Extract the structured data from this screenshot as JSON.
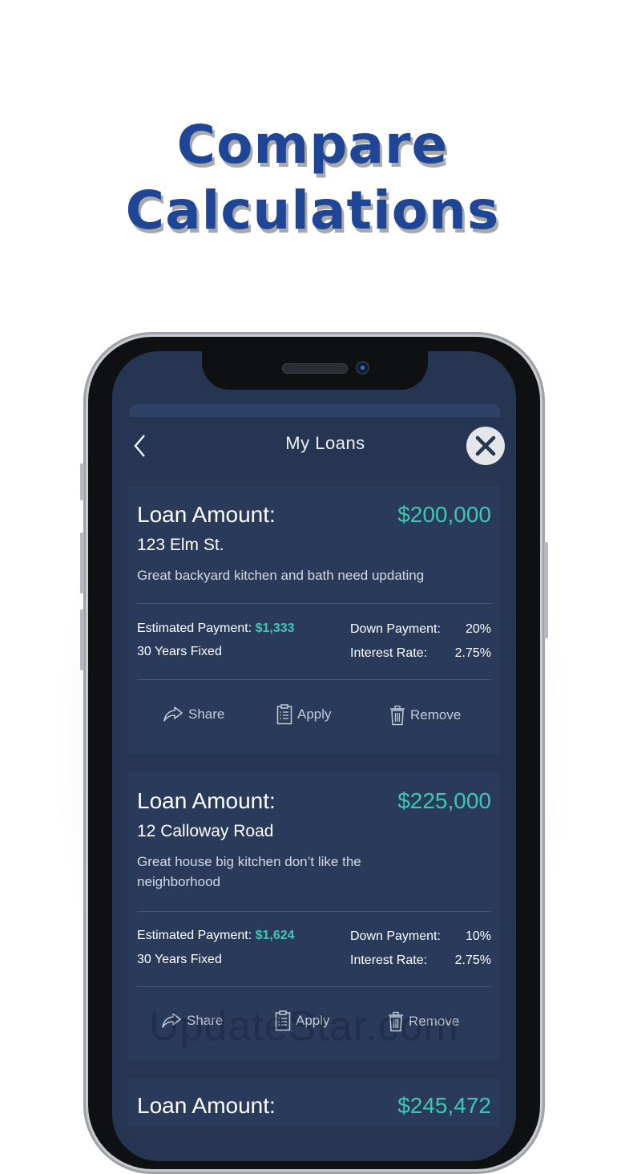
{
  "headline": {
    "line1": "Compare",
    "line2": "Calculations"
  },
  "screen": {
    "title": "My Loans",
    "back_glyph": "‹",
    "close_glyph": "✕"
  },
  "loans": [
    {
      "label": "Loan Amount:",
      "amount": "$200,000",
      "address": "123 Elm St.",
      "note": "Great backyard kitchen and bath need updating",
      "est_label": "Estimated Payment:",
      "est_value": "$1,333",
      "term": "30 Years Fixed",
      "down_label": "Down Payment:",
      "down_value": "20%",
      "rate_label": "Interest Rate:",
      "rate_value": "2.75%",
      "share": "Share",
      "apply": "Apply",
      "remove": "Remove"
    },
    {
      "label": "Loan Amount:",
      "amount": "$225,000",
      "address": "12 Calloway Road",
      "note": "Great house big kitchen don’t like the neighborhood",
      "est_label": "Estimated Payment:",
      "est_value": "$1,624",
      "term": "30 Years Fixed",
      "down_label": "Down Payment:",
      "down_value": "10%",
      "rate_label": "Interest Rate:",
      "rate_value": "2.75%",
      "share": "Share",
      "apply": "Apply",
      "remove": "Remove"
    },
    {
      "label": "Loan Amount:",
      "amount": "$245,472"
    }
  ],
  "watermark": "UpdateStar.com",
  "icons": {
    "share": "share-icon",
    "apply": "clipboard-icon",
    "remove": "trash-icon",
    "close": "close-icon",
    "back": "chevron-left-icon"
  },
  "colors": {
    "headline": "#1f4696",
    "accent": "#3ec8b3",
    "screen_bg": "#263552",
    "card_bg": "#2a3a5a"
  }
}
